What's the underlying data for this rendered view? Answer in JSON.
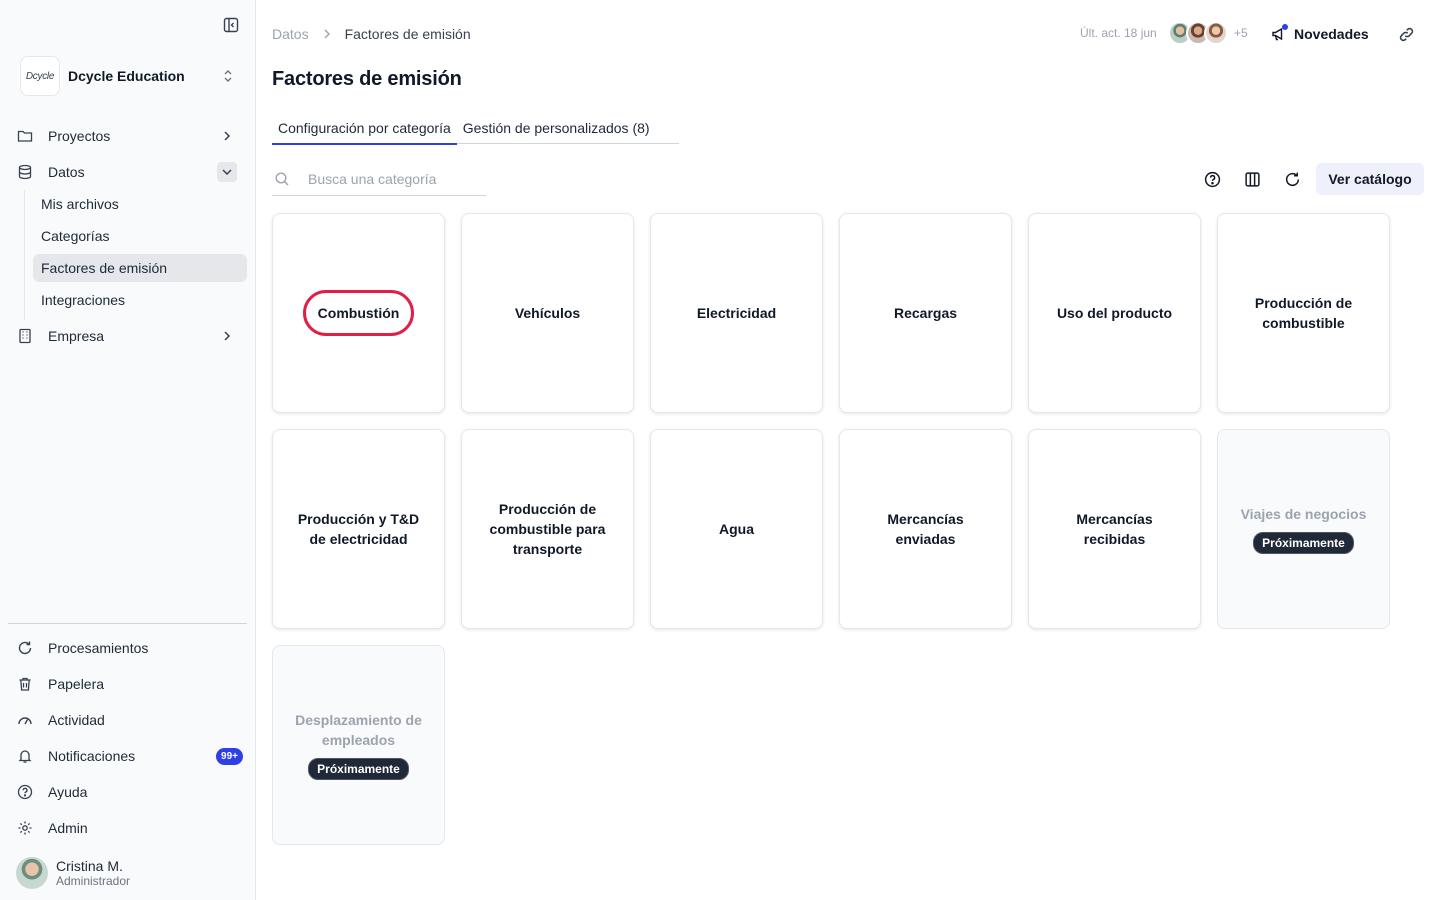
{
  "sidebar": {
    "org_logo": "Dcycle",
    "org_name": "Dcycle Education",
    "nav": {
      "proyectos": "Proyectos",
      "datos": "Datos",
      "empresa": "Empresa"
    },
    "datos_sub": [
      "Mis archivos",
      "Categorías",
      "Factores de emisión",
      "Integraciones"
    ],
    "bottom": {
      "procesamientos": "Procesamientos",
      "papelera": "Papelera",
      "actividad": "Actividad",
      "notificaciones": "Notificaciones",
      "notif_badge": "99+",
      "ayuda": "Ayuda",
      "admin": "Admin"
    },
    "user": {
      "name": "Cristina M.",
      "role": "Administrador"
    }
  },
  "header": {
    "breadcrumb": [
      "Datos",
      "Factores de emisión"
    ],
    "last_update": "Últ. act. 18 jun",
    "collaborators_more": "+5",
    "news_label": "Novedades"
  },
  "page": {
    "title": "Factores de emisión",
    "tabs": [
      "Configuración por categoría",
      "Gestión de personalizados (8)"
    ],
    "search_placeholder": "Busca una categoría",
    "catalog_button": "Ver catálogo"
  },
  "categories": [
    {
      "title": "Combustión",
      "enabled": true,
      "highlighted": true
    },
    {
      "title": "Vehículos",
      "enabled": true
    },
    {
      "title": "Electricidad",
      "enabled": true
    },
    {
      "title": "Recargas",
      "enabled": true
    },
    {
      "title": "Uso del producto",
      "enabled": true
    },
    {
      "title": "Producción de combustible",
      "enabled": true
    },
    {
      "title": "Producción y T&D de electricidad",
      "enabled": true
    },
    {
      "title": "Producción de combustible para transporte",
      "enabled": true
    },
    {
      "title": "Agua",
      "enabled": true
    },
    {
      "title": "Mercancías enviadas",
      "enabled": true
    },
    {
      "title": "Mercancías recibidas",
      "enabled": true
    },
    {
      "title": "Viajes de negocios",
      "enabled": false,
      "badge": "Próximamente"
    },
    {
      "title": "Desplazamiento de empleados",
      "enabled": false,
      "badge": "Próximamente"
    }
  ],
  "colors": {
    "accent": "#2f3fe6",
    "highlight_ring": "#e11d48",
    "sidebar_bg": "#f9fafb"
  }
}
